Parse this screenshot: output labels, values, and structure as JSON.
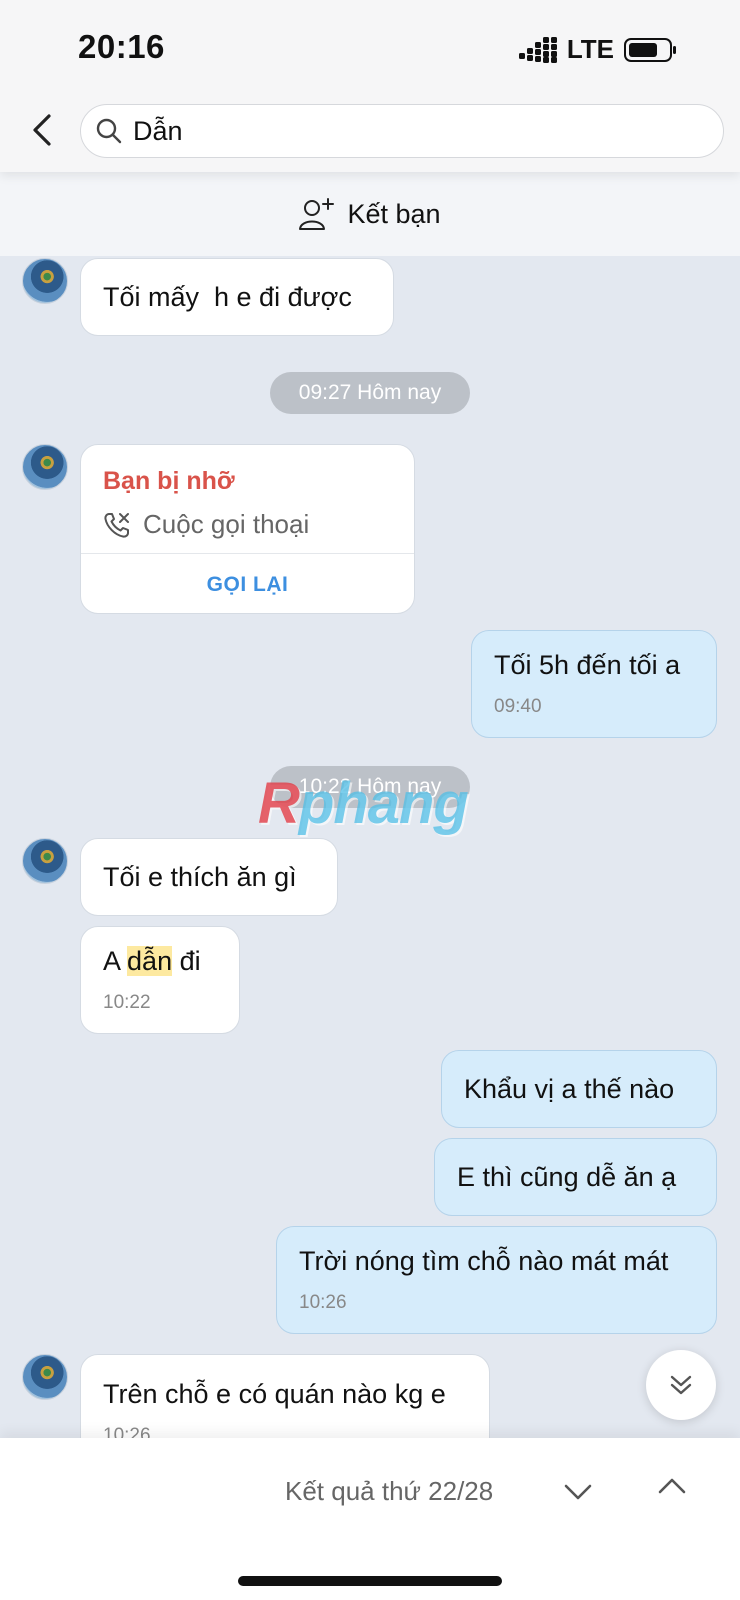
{
  "status_bar": {
    "time": "20:16",
    "network": "LTE"
  },
  "search": {
    "value": "Dẫn"
  },
  "add_friend": {
    "label": "Kết bạn"
  },
  "messages": {
    "m1": {
      "text": "Tối mấy  h e đi được"
    },
    "pill1": "09:27 Hôm nay",
    "missed_call": {
      "title": "Bạn bị nhỡ",
      "label": "Cuộc gọi thoại",
      "action": "GỌI LẠI"
    },
    "m2": {
      "text": "Tối 5h đến tối a",
      "time": "09:40"
    },
    "pill2": "10:22 Hôm nay",
    "m3": {
      "text": "Tối e thích ăn gì"
    },
    "m4": {
      "prefix": "A ",
      "highlight": "dẫn",
      "suffix": " đi",
      "time": "10:22"
    },
    "m5": {
      "text": "Khẩu vị a thế nào"
    },
    "m6": {
      "text": "E thì cũng dễ ăn ạ"
    },
    "m7": {
      "text": "Trời nóng tìm chỗ nào mát mát",
      "time": "10:26"
    },
    "m8": {
      "text": "Trên chỗ e có quán nào kg e",
      "time": "10:26"
    }
  },
  "watermark": {
    "part1": "R",
    "part2": "phang"
  },
  "bottom": {
    "result": "Kết quả thứ 22/28"
  },
  "colors": {
    "missed_call": "#d9534a",
    "link": "#3d8fe0",
    "outgoing": "#d6ecfb",
    "background": "#e3e8f0"
  }
}
